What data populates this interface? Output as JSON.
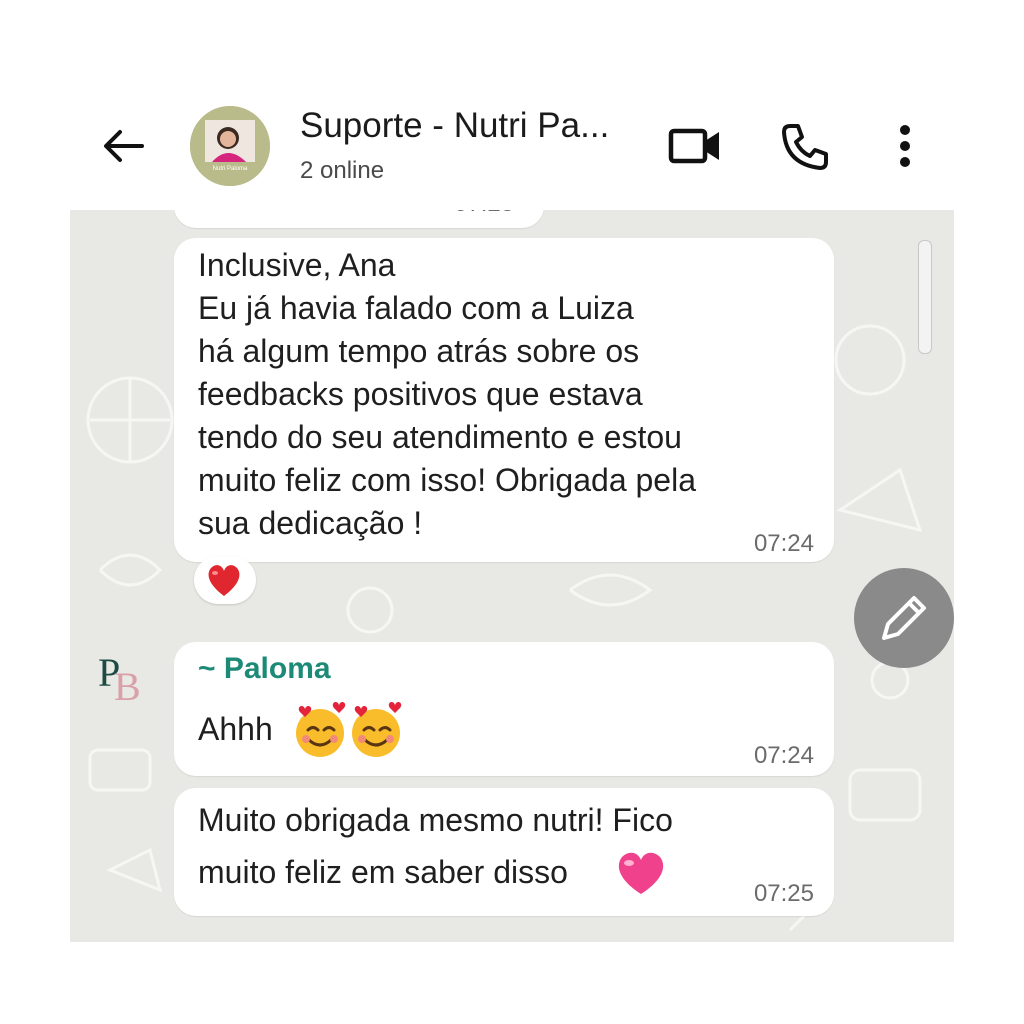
{
  "header": {
    "back_icon": "arrow-left-icon",
    "title": "Suporte - Nutri Pa...",
    "subtitle": "2 online",
    "avatar_caption": "Nutri Paloma",
    "video_icon": "video-call-icon",
    "call_icon": "phone-icon",
    "menu_icon": "more-vertical-icon"
  },
  "messages": [
    {
      "text": "Inclusive, Ana\nEu já havia falado com a Luiza\nhá algum tempo atrás sobre os\nfeedbacks positivos que estava\ntendo do seu atendimento e estou\nmuito feliz com isso! Obrigada pela\nsua dedicação !",
      "time": "07:24",
      "reaction": "❤️"
    },
    {
      "sender": "~ Paloma",
      "text": "Ahhh",
      "time": "07:24"
    },
    {
      "text": "Muito obrigada mesmo nutri! Fico\nmuito feliz em saber disso",
      "time": "07:25"
    }
  ],
  "sender_avatar": "PB",
  "compose_icon": "pencil-icon",
  "colors": {
    "sender_name": "#1d8a78",
    "chat_background": "#e8e9e4",
    "bubble": "#ffffff",
    "compose_button": "#8a8a8a"
  }
}
